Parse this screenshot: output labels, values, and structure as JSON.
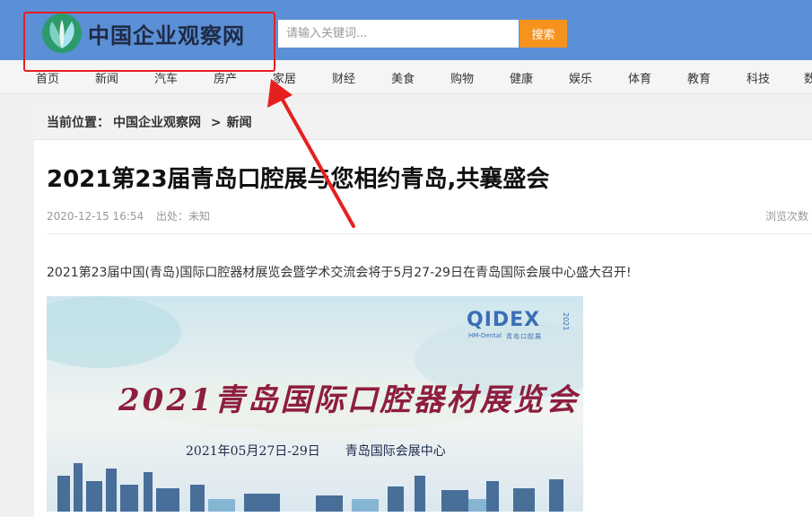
{
  "header": {
    "site_name": "中国企业观察网",
    "search_placeholder": "请输入关键词...",
    "search_button": "搜索"
  },
  "nav": {
    "items": [
      "首页",
      "新闻",
      "汽车",
      "房产",
      "家居",
      "财经",
      "美食",
      "购物",
      "健康",
      "娱乐",
      "体育",
      "教育",
      "科技",
      "数"
    ]
  },
  "breadcrumb": {
    "prefix": "当前位置：",
    "home": "中国企业观察网",
    "sep": ">",
    "current": "新闻"
  },
  "article": {
    "title": "2021第23届青岛口腔展与您相约青岛,共襄盛会",
    "date": "2020-12-15 16:54",
    "source": "出处：未知",
    "views": "浏览次数",
    "intro": "2021第23届中国(青岛)国际口腔器材展览会暨学术交流会将于5月27-29日在青岛国际会展中心盛大召开!"
  },
  "banner": {
    "brand": "QIDEX",
    "brand_sub": "HM-Dental",
    "brand_cn": "青岛口腔展",
    "brand_year": "2021",
    "title": "2021青岛国际口腔器材展览会",
    "date_line": "2021年05月27日-29日　　青岛国际会展中心"
  },
  "colors": {
    "header_bg": "#5b8fd6",
    "search_button": "#f6921e",
    "annotation": "#e6201f"
  }
}
